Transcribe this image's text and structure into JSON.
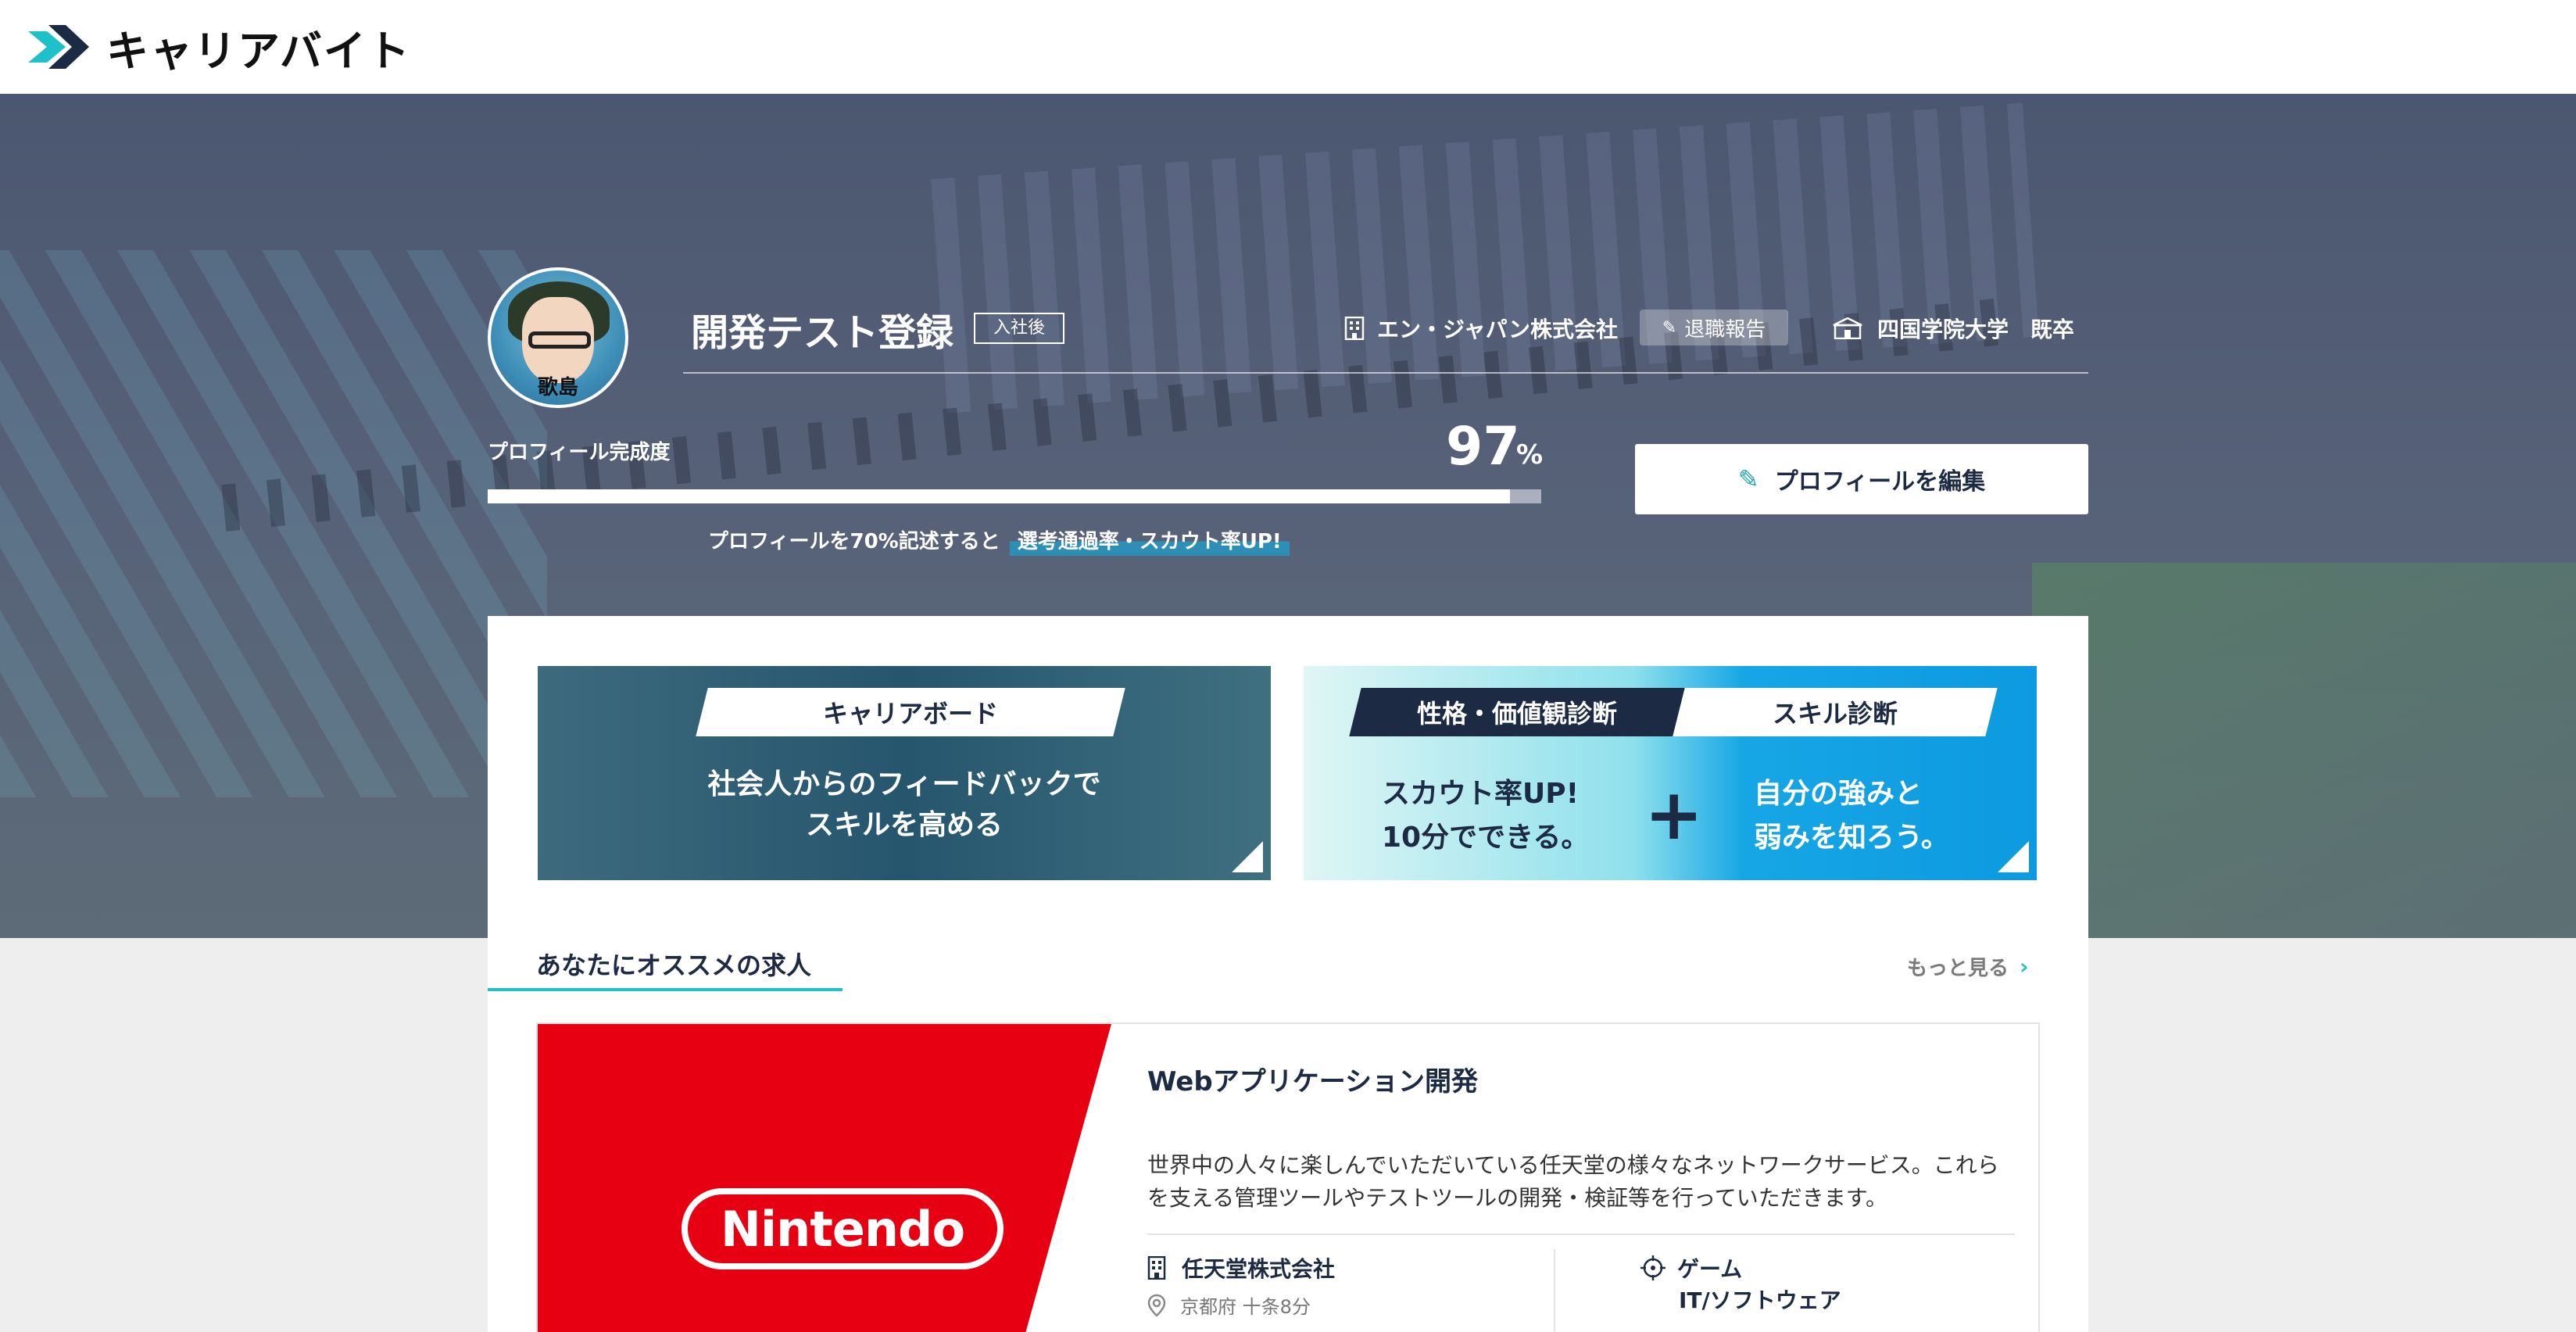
{
  "header": {
    "logo_text": "キャリアバイト"
  },
  "profile": {
    "avatar_name": "歌島",
    "name": "開発テスト登録",
    "status_badge": "入社後",
    "company": "エン・ジャパン株式会社",
    "retire_label": "退職報告",
    "school": "四国学院大学",
    "graduation": "既卒",
    "completion_label": "プロフィール完成度",
    "completion_value": "97",
    "completion_unit": "%",
    "completion_fraction": 0.97,
    "hint_prefix": "プロフィールを70%記述すると",
    "hint_highlight": "選考通過率・スカウト率UP!",
    "edit_label": "プロフィールを編集"
  },
  "banners": {
    "career_board": {
      "tag": "キャリアボード",
      "line1": "社会人からのフィードバックで",
      "line2": "スキルを高める"
    },
    "diagnosis": {
      "tag1": "性格・価値観診断",
      "tag2": "スキル診断",
      "left_line1": "スカウト率UP!",
      "left_line2": "10分でできる。",
      "plus": "+",
      "right_line1": "自分の強みと",
      "right_line2": "弱みを知ろう。"
    }
  },
  "recommend": {
    "title": "あなたにオススメの求人",
    "more_label": "もっと見る",
    "job": {
      "logo": "Nintendo",
      "title": "Webアプリケーション開発",
      "description": "世界中の人々に楽しんでいただいている任天堂の様々なネットワークサービス。これらを支える管理ツールやテストツールの開発・検証等を行っていただきます。",
      "company": "任天堂株式会社",
      "location": "京都府 十条8分",
      "category": "ゲーム",
      "category_sub": "IT/ソフトウェア"
    }
  },
  "colors": {
    "accent": "#1ec1c9",
    "navy": "#1d2a44",
    "nintendo_red": "#e60012"
  }
}
